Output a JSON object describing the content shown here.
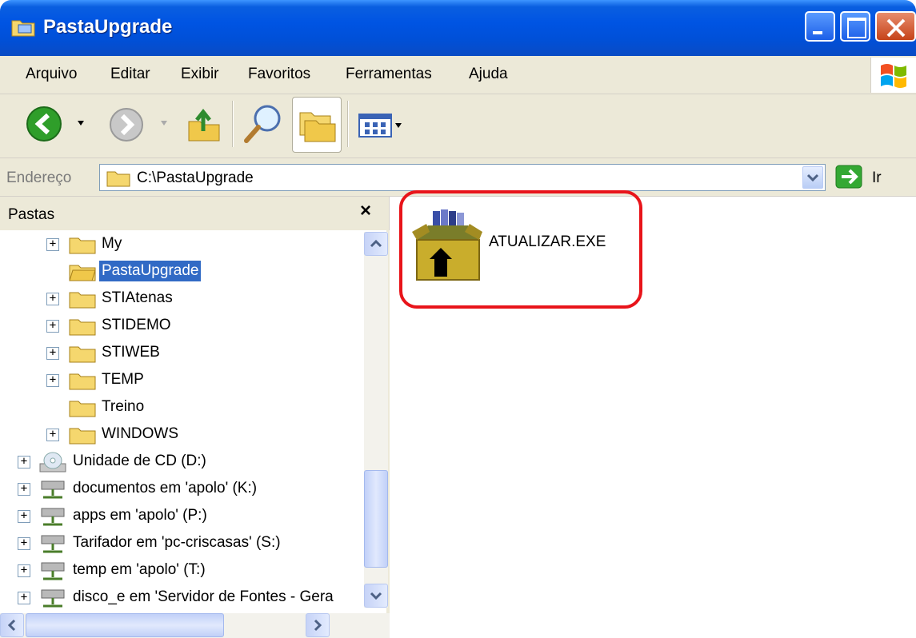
{
  "window": {
    "title": "PastaUpgrade",
    "icon": "folder-icon"
  },
  "menu": [
    "Arquivo",
    "Editar",
    "Exibir",
    "Favoritos",
    "Ferramentas",
    "Ajuda"
  ],
  "toolbar": {
    "buttons": [
      "back-icon",
      "forward-icon",
      "up-folder-icon",
      "search-icon",
      "folders-icon",
      "views-icon"
    ]
  },
  "address": {
    "label": "Endereço",
    "value": "C:\\PastaUpgrade",
    "go_label": "Ir"
  },
  "folders_pane": {
    "title": "Pastas",
    "close": "×",
    "items": [
      {
        "label": "My",
        "expandable": true,
        "icon": "folder-icon"
      },
      {
        "label": "PastaUpgrade",
        "expandable": false,
        "selected": true,
        "icon": "folder-open-icon"
      },
      {
        "label": "STIAtenas",
        "expandable": true,
        "icon": "folder-icon"
      },
      {
        "label": "STIDEMO",
        "expandable": true,
        "icon": "folder-icon"
      },
      {
        "label": "STIWEB",
        "expandable": true,
        "icon": "folder-icon"
      },
      {
        "label": "TEMP",
        "expandable": true,
        "icon": "folder-icon"
      },
      {
        "label": "Treino",
        "expandable": false,
        "icon": "folder-icon"
      },
      {
        "label": "WINDOWS",
        "expandable": true,
        "icon": "folder-icon"
      },
      {
        "label": "Unidade de CD (D:)",
        "expandable": true,
        "icon": "cd-drive-icon"
      },
      {
        "label": "documentos em 'apolo' (K:)",
        "expandable": true,
        "icon": "network-drive-icon"
      },
      {
        "label": "apps em 'apolo' (P:)",
        "expandable": true,
        "icon": "network-drive-icon"
      },
      {
        "label": "Tarifador em 'pc-criscasas' (S:)",
        "expandable": true,
        "icon": "network-drive-icon"
      },
      {
        "label": "temp em 'apolo' (T:)",
        "expandable": true,
        "icon": "network-drive-icon"
      },
      {
        "label": "disco_e em 'Servidor de Fontes - Gera",
        "expandable": true,
        "icon": "network-drive-icon"
      }
    ]
  },
  "files": [
    {
      "name": "ATUALIZAR.EXE",
      "icon": "installer-box-icon"
    }
  ],
  "colors": {
    "titlebar": "#0054e3",
    "highlight": "#e8141a",
    "selection": "#316ac5"
  }
}
